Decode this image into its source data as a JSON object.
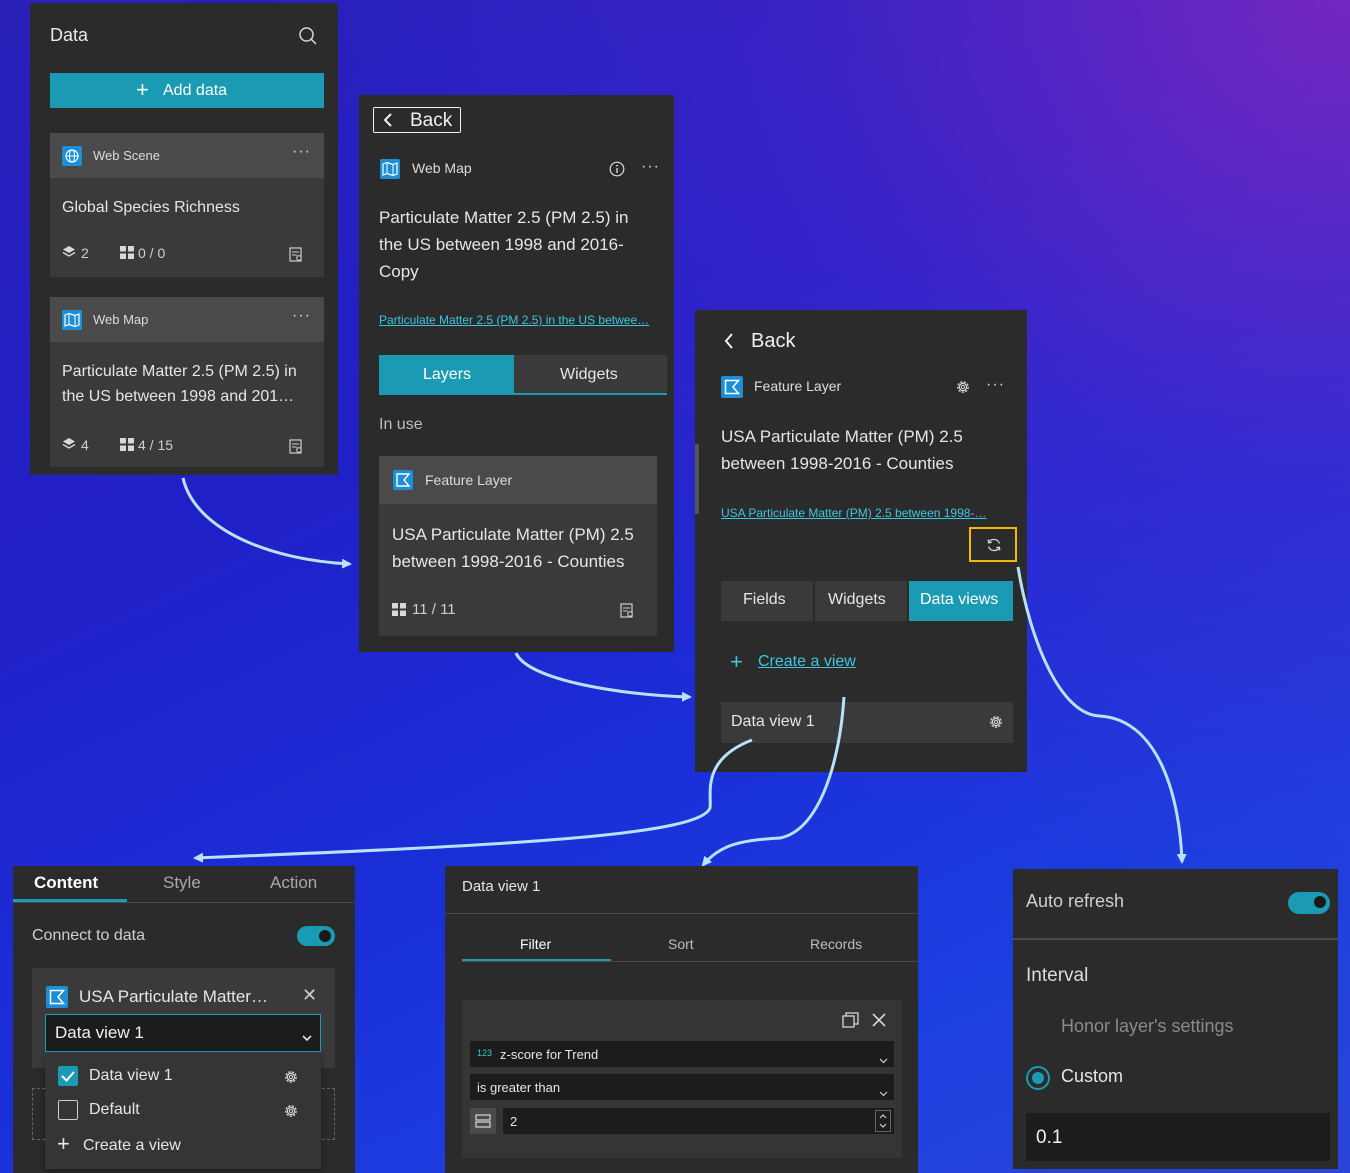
{
  "data_panel": {
    "title": "Data",
    "add_button": "Add data",
    "cards": [
      {
        "type": "Web Scene",
        "title": "Global Species Richness",
        "layers": "2",
        "widgets": "0 / 0"
      },
      {
        "type": "Web Map",
        "title_line1": "Particulate Matter 2.5 (PM 2.5) in",
        "title_line2": "the US between 1998 and 201…",
        "layers": "4",
        "widgets": "4 / 15"
      }
    ]
  },
  "webmap_panel": {
    "back": "Back",
    "type": "Web Map",
    "title_lines": [
      "Particulate Matter 2.5 (PM 2.5) in",
      "the US between 1998 and 2016-",
      "Copy"
    ],
    "link": "Particulate Matter 2.5 (PM 2.5) in the US betwee…",
    "tabs": [
      "Layers",
      "Widgets"
    ],
    "section": "In use",
    "layer_card": {
      "type": "Feature Layer",
      "title_lines": [
        "USA Particulate Matter (PM) 2.5",
        "between 1998-2016 - Counties"
      ],
      "widgets": "11 / 11"
    }
  },
  "layer_panel": {
    "back": "Back",
    "type": "Feature Layer",
    "title_lines": [
      "USA Particulate Matter (PM) 2.5",
      "between 1998-2016 - Counties"
    ],
    "link": "USA Particulate Matter (PM) 2.5 between 1998-…",
    "tabs": [
      "Fields",
      "Widgets",
      "Data views"
    ],
    "create_view": "Create a view",
    "data_view": "Data view 1"
  },
  "content_panel": {
    "tabs": [
      "Content",
      "Style",
      "Action"
    ],
    "connect_label": "Connect to data",
    "source_name": "USA Particulate Matter…",
    "selected_view": "Data view 1",
    "options": [
      {
        "label": "Data view 1",
        "checked": true
      },
      {
        "label": "Default",
        "checked": false
      }
    ],
    "create_view": "Create a view"
  },
  "dataview_panel": {
    "title": "Data view 1",
    "tabs": [
      "Filter",
      "Sort",
      "Records"
    ],
    "field_badge": "123",
    "field": "z-score for Trend",
    "operator": "is greater than",
    "value": "2"
  },
  "refresh_panel": {
    "auto_refresh": "Auto refresh",
    "interval": "Interval",
    "honor": "Honor layer's settings",
    "custom": "Custom",
    "value": "0.1"
  },
  "colors": {
    "accent": "#1a9bb3",
    "link": "#3ec6e0",
    "highlight": "#f5b800",
    "arrow": "#b8e2f7"
  }
}
